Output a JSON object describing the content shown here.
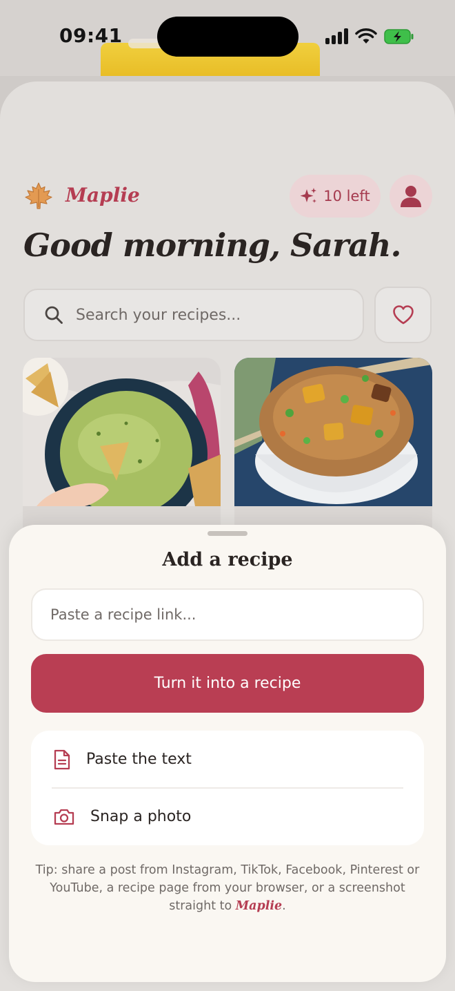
{
  "status_bar": {
    "time": "09:41"
  },
  "header": {
    "brand": "Maplie",
    "credits_label": "10 left",
    "greeting": "Good morning, Sarah."
  },
  "search": {
    "placeholder": "Search your recipes..."
  },
  "recipes": [
    {
      "image": "guacamole-with-tortilla-chips"
    },
    {
      "image": "tofu-fried-rice"
    }
  ],
  "sheet": {
    "title": "Add a recipe",
    "link_placeholder": "Paste a recipe link...",
    "primary_button": "Turn it into a recipe",
    "options": [
      {
        "label": "Paste the text",
        "icon": "document-icon"
      },
      {
        "label": "Snap a photo",
        "icon": "camera-icon"
      }
    ],
    "tip_text": "Tip: share a post from Instagram, TikTok, Facebook, Pinterest or YouTube, a recipe page from your browser, or a screenshot straight to",
    "tip_brand": "Maplie",
    "tip_end": "."
  },
  "colors": {
    "accent": "#b93e53",
    "brand_text": "#b53d52",
    "pill_bg": "#ecd4d6",
    "sheet_bg": "#faf7f2",
    "card_bg": "#e2dfdc"
  }
}
